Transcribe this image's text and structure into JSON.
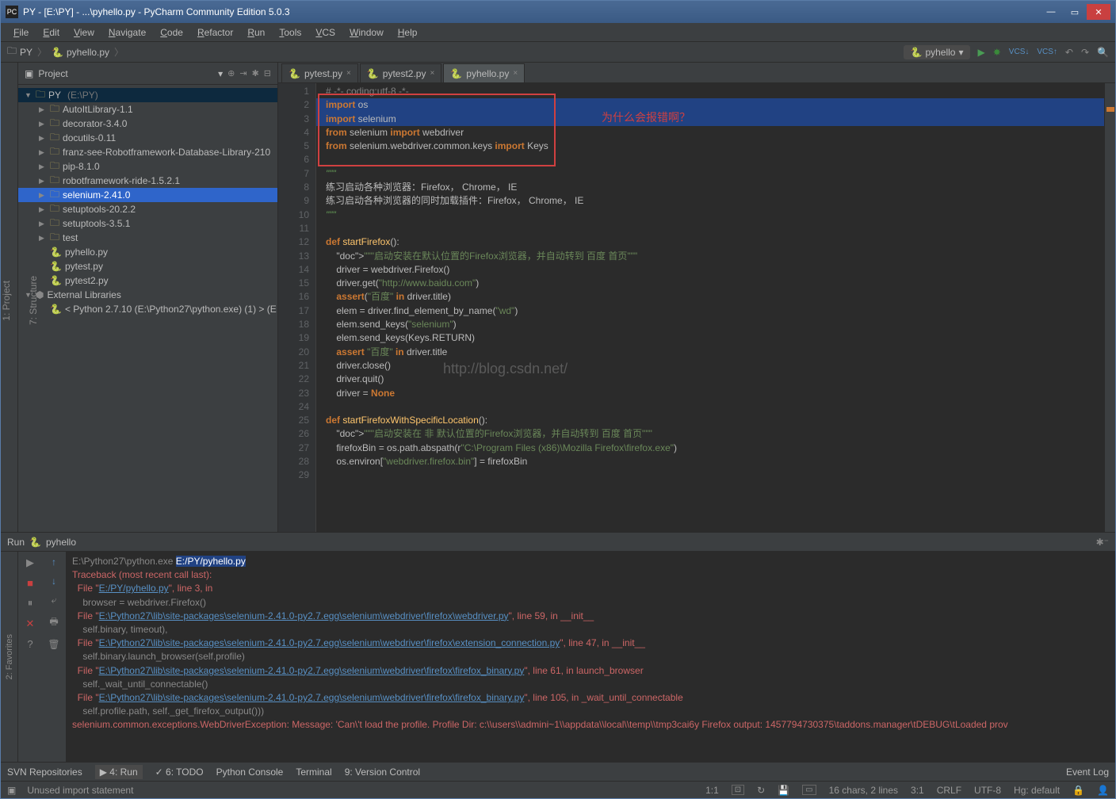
{
  "window": {
    "title": "PY - [E:\\PY] - ...\\pyhello.py - PyCharm Community Edition 5.0.3"
  },
  "menu": [
    "File",
    "Edit",
    "View",
    "Navigate",
    "Code",
    "Refactor",
    "Run",
    "Tools",
    "VCS",
    "Window",
    "Help"
  ],
  "breadcrumb": {
    "project": "PY",
    "file": "pyhello.py"
  },
  "runconfig": "pyhello",
  "sidebar": {
    "title": "Project",
    "tree": [
      {
        "d": 0,
        "t": "PY",
        "hint": "(E:\\PY)",
        "ico": "📁",
        "open": true,
        "sel": true
      },
      {
        "d": 1,
        "t": "AutoItLibrary-1.1",
        "ico": "📁"
      },
      {
        "d": 1,
        "t": "decorator-3.4.0",
        "ico": "📁"
      },
      {
        "d": 1,
        "t": "docutils-0.11",
        "ico": "📁"
      },
      {
        "d": 1,
        "t": "franz-see-Robotframework-Database-Library-210",
        "ico": "📁"
      },
      {
        "d": 1,
        "t": "pip-8.1.0",
        "ico": "📁"
      },
      {
        "d": 1,
        "t": "robotframework-ride-1.5.2.1",
        "ico": "📁"
      },
      {
        "d": 1,
        "t": "selenium-2.41.0",
        "ico": "📁",
        "hov": true
      },
      {
        "d": 1,
        "t": "setuptools-20.2.2",
        "ico": "📁"
      },
      {
        "d": 1,
        "t": "setuptools-3.5.1",
        "ico": "📁"
      },
      {
        "d": 1,
        "t": "test",
        "ico": "📁"
      },
      {
        "d": 1,
        "t": "pyhello.py",
        "ico": "py"
      },
      {
        "d": 1,
        "t": "pytest.py",
        "ico": "py"
      },
      {
        "d": 1,
        "t": "pytest2.py",
        "ico": "py"
      },
      {
        "d": 0,
        "t": "External Libraries",
        "ico": "lib",
        "open": true
      },
      {
        "d": 1,
        "t": "< Python 2.7.10 (E:\\Python27\\python.exe) (1) > (E",
        "ico": "py"
      }
    ]
  },
  "tabs": [
    {
      "label": "pytest.py"
    },
    {
      "label": "pytest2.py"
    },
    {
      "label": "pyhello.py",
      "active": true
    }
  ],
  "code": {
    "lines": [
      "# -*- coding:utf-8 -*-",
      "import os",
      "import selenium",
      "from selenium import webdriver",
      "from selenium.webdriver.common.keys import Keys",
      "",
      "\"\"\"",
      "练习启动各种浏览器：Firefox， Chrome， IE",
      "练习启动各种浏览器的同时加载插件：Firefox， Chrome， IE",
      "\"\"\"",
      "",
      "def startFirefox():",
      "    \"\"\"启动安装在默认位置的Firefox浏览器，并自动转到 百度 首页\"\"\"",
      "    driver = webdriver.Firefox()",
      "    driver.get(\"http://www.baidu.com\")",
      "    assert(\"百度\" in driver.title)",
      "    elem = driver.find_element_by_name(\"wd\")",
      "    elem.send_keys(\"selenium\")",
      "    elem.send_keys(Keys.RETURN)",
      "    assert \"百度\" in driver.title",
      "    driver.close()",
      "    driver.quit()",
      "    driver = None",
      "",
      "def startFirefoxWithSpecificLocation():",
      "    \"\"\"启动安装在 非 默认位置的Firefox浏览器，并自动转到 百度 首页\"\"\"",
      "    firefoxBin = os.path.abspath(r\"C:\\Program Files (x86)\\Mozilla Firefox\\firefox.exe\")",
      "    os.environ[\"webdriver.firefox.bin\"] = firefoxBin",
      ""
    ]
  },
  "annotation": "为什么会报错啊？",
  "watermark": "http://blog.csdn.net/",
  "run": {
    "title": "Run",
    "name": "pyhello",
    "lines": [
      {
        "pre": "E:\\Python27\\python.exe ",
        "sel": "E:/PY/pyhello.py"
      },
      {
        "err": "Traceback (most recent call last):"
      },
      {
        "pre": "  File \"",
        "link": "E:/PY/pyhello.py",
        "post": "\", line 3, in <module>",
        "err": true
      },
      {
        "txt": "    browser = webdriver.Firefox()"
      },
      {
        "pre": "  File \"",
        "link": "E:\\Python27\\lib\\site-packages\\selenium-2.41.0-py2.7.egg\\selenium\\webdriver\\firefox\\webdriver.py",
        "post": "\", line 59, in __init__",
        "err": true
      },
      {
        "txt": "    self.binary, timeout),"
      },
      {
        "pre": "  File \"",
        "link": "E:\\Python27\\lib\\site-packages\\selenium-2.41.0-py2.7.egg\\selenium\\webdriver\\firefox\\extension_connection.py",
        "post": "\", line 47, in __init__",
        "err": true
      },
      {
        "txt": "    self.binary.launch_browser(self.profile)"
      },
      {
        "pre": "  File \"",
        "link": "E:\\Python27\\lib\\site-packages\\selenium-2.41.0-py2.7.egg\\selenium\\webdriver\\firefox\\firefox_binary.py",
        "post": "\", line 61, in launch_browser",
        "err": true
      },
      {
        "txt": "    self._wait_until_connectable()"
      },
      {
        "pre": "  File \"",
        "link": "E:\\Python27\\lib\\site-packages\\selenium-2.41.0-py2.7.egg\\selenium\\webdriver\\firefox\\firefox_binary.py",
        "post": "\", line 105, in _wait_until_connectable",
        "err": true
      },
      {
        "txt": "    self.profile.path, self._get_firefox_output()))"
      },
      {
        "err": "selenium.common.exceptions.WebDriverException: Message: 'Can\\'t load the profile. Profile Dir: c:\\\\users\\\\admini~1\\\\appdata\\\\local\\\\temp\\\\tmp3cai6y Firefox output: 1457794730375\\taddons.manager\\tDEBUG\\tLoaded prov"
      }
    ]
  },
  "bottombar": {
    "items": [
      "SVN Repositories",
      "▶ 4: Run",
      "✓ 6: TODO",
      "Python Console",
      "Terminal",
      "9: Version Control"
    ],
    "right": "Event Log"
  },
  "status": {
    "msg": "Unused import statement",
    "ratio": "1:1",
    "info": "16 chars, 2 lines",
    "pos": "3:1",
    "eol": "CRLF",
    "enc": "UTF-8",
    "hg": "Hg: default"
  },
  "leftgutter": [
    "1: Project",
    "7: Structure"
  ],
  "favgutter": "2: Favorites"
}
